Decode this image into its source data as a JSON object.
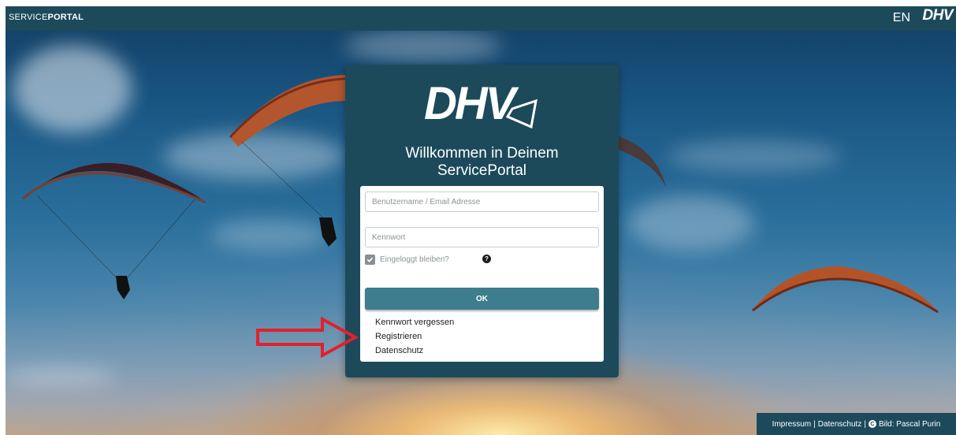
{
  "topbar": {
    "brand_light": "SERVICE",
    "brand_bold": "PORTAL",
    "lang_label": "EN",
    "logo_text": "DHV"
  },
  "panel": {
    "logo_text": "DHV",
    "welcome_line1": "Willkommen in Deinem",
    "welcome_line2": "ServicePortal"
  },
  "form": {
    "username_placeholder": "Benutzername / Email Adresse",
    "username_value": "",
    "password_placeholder": "Kennwort",
    "password_value": "",
    "remember_label": "Eingeloggt bleiben?",
    "remember_checked": true,
    "help_glyph": "?",
    "ok_label": "OK"
  },
  "links": {
    "forgot": "Kennwort vergessen",
    "register": "Registrieren",
    "privacy": "Datenschutz"
  },
  "footer": {
    "impressum": "Impressum",
    "sep1": "|",
    "datenschutz": "Datenschutz",
    "sep2": "|",
    "cc_glyph": "C",
    "credit": "Bild: Pascal Purin"
  },
  "colors": {
    "brand_teal": "#1c4a5b",
    "button_teal": "#3d7d8d",
    "arrow_red": "#e3202a"
  },
  "icons": [
    "check-icon",
    "help-icon",
    "cc-icon",
    "red-arrow-annotation"
  ]
}
